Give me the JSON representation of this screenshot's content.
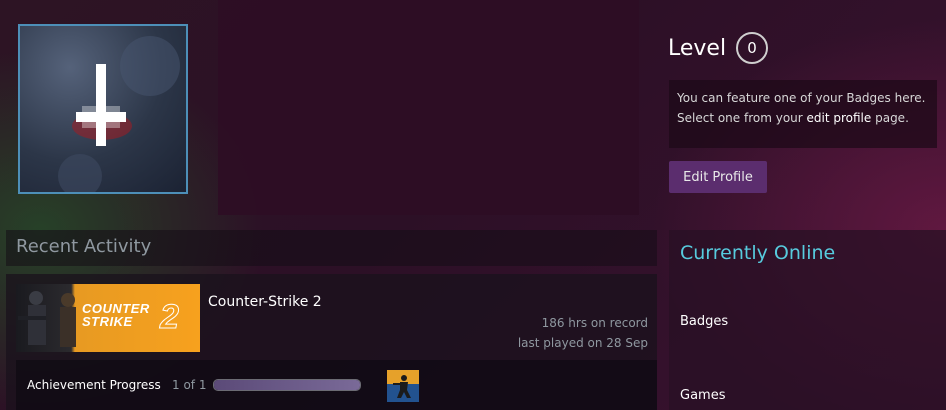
{
  "profile": {
    "avatar_icon": "inverted-cross-icon"
  },
  "level": {
    "label": "Level",
    "value": "0"
  },
  "badge_box": {
    "text_before": "You can feature one of your Badges here. Select one from your ",
    "link": "edit profile",
    "text_after": " page."
  },
  "edit_button": {
    "label": "Edit Profile"
  },
  "recent_activity": {
    "title": "Recent Activity",
    "game": {
      "name": "Counter-Strike 2",
      "capsule_logo_line1": "COUNTER",
      "capsule_logo_line2": "STRIKE",
      "capsule_logo_number": "2",
      "hours": "186 hrs on record",
      "last_played": "last played on 28 Sep",
      "achievement": {
        "label": "Achievement Progress",
        "count": "1 of 1",
        "progress": 1.0,
        "icon": "cs2-achievement-icon"
      }
    }
  },
  "sidebar": {
    "status_title": "Currently Online",
    "links": [
      "Badges",
      "Games"
    ]
  },
  "colors": {
    "online_accent": "#57cbde",
    "button_bg": "#5b2d6e",
    "avatar_border": "#4d8fb8"
  }
}
